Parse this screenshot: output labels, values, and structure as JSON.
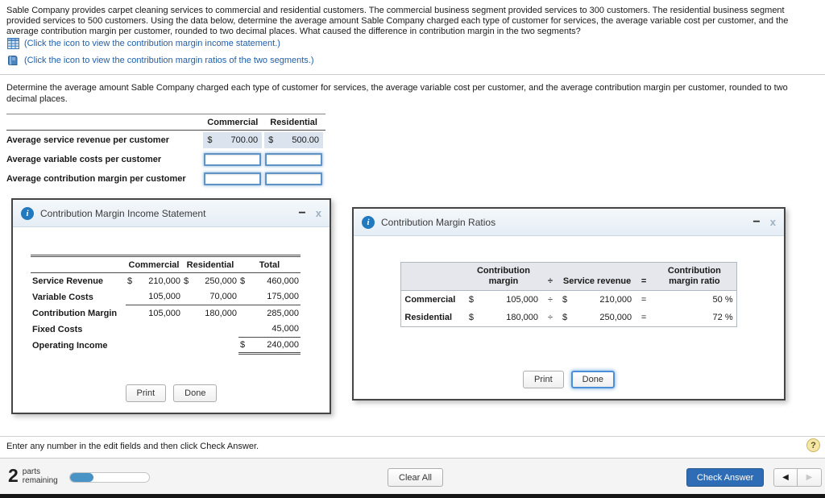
{
  "colors": {
    "link_blue": "#1f5fa9",
    "popup_header_bg": "#e9f0f7",
    "shaded_cell_bg": "#dbe4ee",
    "input_border_blue": "#5f93c6",
    "check_answer_bg": "#2e6db5",
    "progress_fill": "#4994c4",
    "info_icon_bg": "#2179c0"
  },
  "problem": {
    "statement": "Sable Company provides carpet cleaning services to commercial and residential customers. The commercial business segment provided services to 300 customers. The residential business segment provided services to 500 customers. Using the data below, determine the average amount Sable Company charged each type of customer for services, the average variable cost per customer, and the average contribution margin per customer, rounded to two decimal places. What caused the difference in contribution margin in the two segments?",
    "income_statement_link": "(Click the icon to view the contribution margin income statement.)",
    "ratios_link": "(Click the icon to view the contribution margin ratios of the two segments.)"
  },
  "task_instruction": "Determine the average amount Sable Company charged each type of customer for services, the average variable cost per customer, and the average contribution margin per customer, rounded to two decimal places.",
  "answer_table": {
    "headers": {
      "commercial": "Commercial",
      "residential": "Residential"
    },
    "rows": [
      {
        "label": "Average service revenue per customer",
        "commercial": {
          "symbol": "$",
          "value": "700.00"
        },
        "residential": {
          "symbol": "$",
          "value": "500.00"
        }
      },
      {
        "label": "Average variable costs per customer"
      },
      {
        "label": "Average contribution margin per customer"
      }
    ]
  },
  "income_statement_window": {
    "title": "Contribution Margin Income Statement",
    "headers": {
      "commercial": "Commercial",
      "residential": "Residential",
      "total": "Total"
    },
    "rows": {
      "service_revenue": {
        "label": "Service Revenue",
        "c_sym": "$",
        "c": "210,000",
        "r_sym": "$",
        "r": "250,000",
        "t_sym": "$",
        "t": "460,000"
      },
      "variable_costs": {
        "label": "Variable Costs",
        "c": "105,000",
        "r": "70,000",
        "t": "175,000"
      },
      "contribution_margin": {
        "label": "Contribution Margin",
        "c": "105,000",
        "r": "180,000",
        "t": "285,000"
      },
      "fixed_costs": {
        "label": "Fixed Costs",
        "t": "45,000"
      },
      "operating_income": {
        "label": "Operating Income",
        "t_sym": "$",
        "t": "240,000"
      }
    },
    "print_label": "Print",
    "done_label": "Done"
  },
  "ratios_window": {
    "title": "Contribution Margin Ratios",
    "headers": {
      "contribution_margin": "Contribution margin",
      "divide": "÷",
      "service_revenue": "Service revenue",
      "equals": "=",
      "ratio": "Contribution margin ratio"
    },
    "rows": [
      {
        "label": "Commercial",
        "cm_sym": "$",
        "cm": "105,000",
        "divide": "÷",
        "sr_sym": "$",
        "sr": "210,000",
        "equals": "=",
        "ratio": "50 %"
      },
      {
        "label": "Residential",
        "cm_sym": "$",
        "cm": "180,000",
        "divide": "÷",
        "sr_sym": "$",
        "sr": "250,000",
        "equals": "=",
        "ratio": "72 %"
      }
    ],
    "print_label": "Print",
    "done_label": "Done"
  },
  "window_controls": {
    "info": "i",
    "minimize": "−",
    "close": "x"
  },
  "footer": {
    "hint": "Enter any number in the edit fields and then click Check Answer.",
    "parts": {
      "count": "2",
      "line1": "parts",
      "line2": "remaining"
    },
    "progress_percent": 30,
    "progress_style": "width:30%",
    "clear_all_label": "Clear All",
    "check_answer_label": "Check Answer",
    "prev_icon": "◀",
    "next_icon": "▶",
    "help_icon": "?"
  }
}
